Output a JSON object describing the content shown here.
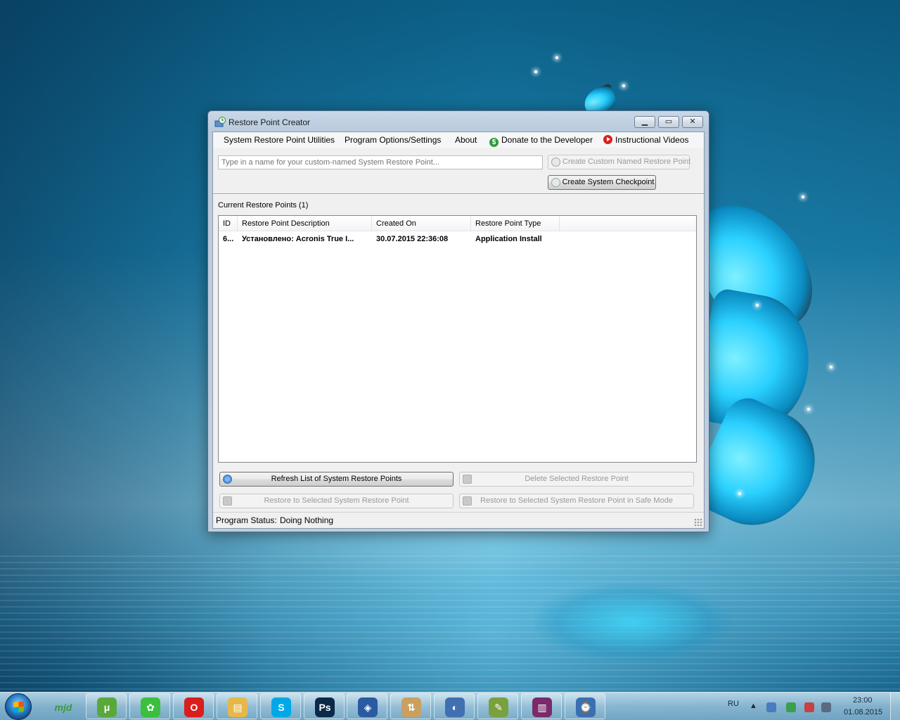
{
  "window": {
    "title": "Restore Point Creator",
    "menu": [
      {
        "label": "System Restore Point Utilities",
        "icon": ""
      },
      {
        "label": "Program Options/Settings",
        "icon": ""
      },
      {
        "label": "About",
        "icon": ""
      },
      {
        "label": "Donate to the Developer",
        "icon": "dollar-icon"
      },
      {
        "label": "Instructional Videos",
        "icon": "play-icon"
      }
    ],
    "name_input": {
      "value": "",
      "placeholder": "Type in a name for your custom-named System Restore Point..."
    },
    "buttons": {
      "create_custom": "Create Custom Named Restore Point",
      "create_checkpoint": "Create System Checkpoint",
      "refresh": "Refresh List of System Restore Points",
      "delete": "Delete Selected Restore Point",
      "restore": "Restore to Selected System Restore Point",
      "restore_safe": "Restore to Selected System Restore Point in Safe Mode"
    },
    "list": {
      "label": "Current Restore Points (1)",
      "columns": [
        "ID",
        "Restore Point Description",
        "Created On",
        "Restore Point Type"
      ],
      "rows": [
        {
          "id": "6...",
          "description": "Установлено: Acronis True I...",
          "created_on": "30.07.2015 22:36:08",
          "type": "Application Install"
        }
      ]
    },
    "status": {
      "label": "Program Status:",
      "value": "Doing Nothing"
    }
  },
  "taskbar": {
    "apps": [
      {
        "name": "mjd-icon",
        "glyph": "mjd",
        "color": "#3a9a3a"
      },
      {
        "name": "utorrent-icon",
        "glyph": "μ",
        "color": "#5aa83a"
      },
      {
        "name": "icq-icon",
        "glyph": "✿",
        "color": "#3cbf3c"
      },
      {
        "name": "opera-icon",
        "glyph": "O",
        "color": "#d81e1e"
      },
      {
        "name": "explorer-folder-icon",
        "glyph": "▤",
        "color": "#e6b84a"
      },
      {
        "name": "skype-icon",
        "glyph": "S",
        "color": "#00a8e8"
      },
      {
        "name": "photoshop-icon",
        "glyph": "Ps",
        "color": "#0b2a4a"
      },
      {
        "name": "virtualbox-icon",
        "glyph": "◈",
        "color": "#2a5aa0"
      },
      {
        "name": "backup-icon",
        "glyph": "⇅",
        "color": "#c8a060"
      },
      {
        "name": "network-globe-icon",
        "glyph": "◐",
        "color": "#4070b0"
      },
      {
        "name": "ccleaner-icon",
        "glyph": "✎",
        "color": "#7aa040"
      },
      {
        "name": "winrar-icon",
        "glyph": "▥",
        "color": "#7a2a6a"
      },
      {
        "name": "restore-point-creator-icon",
        "glyph": "⌚",
        "color": "#3a70b0"
      }
    ],
    "language": "RU",
    "time": "23:00",
    "date": "01.08.2015"
  }
}
